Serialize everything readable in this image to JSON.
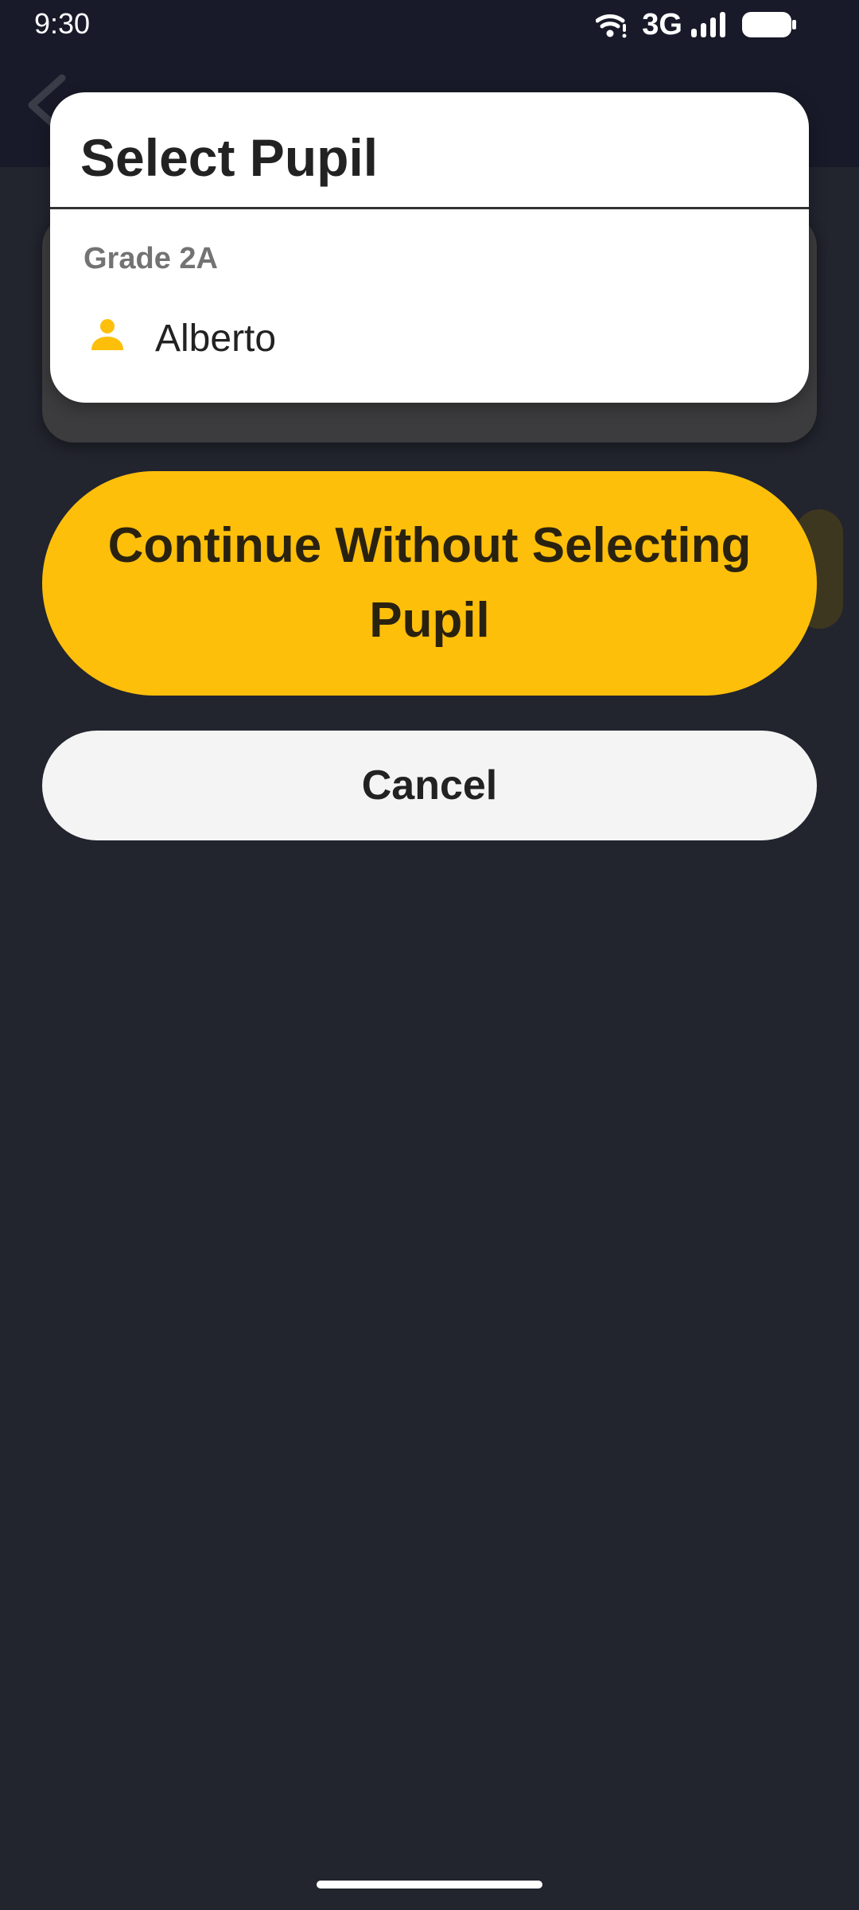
{
  "status_bar": {
    "time": "9:30",
    "network": "3G",
    "icons": [
      "wifi-icon",
      "signal-icon",
      "battery-icon"
    ]
  },
  "dialog": {
    "title": "Select Pupil",
    "groups": [
      {
        "name": "Grade 2A",
        "pupils": [
          {
            "name": "Alberto",
            "icon": "person-icon"
          }
        ]
      }
    ]
  },
  "actions": {
    "continue_label": "Continue Without Selecting Pupil",
    "cancel_label": "Cancel"
  },
  "colors": {
    "accent": "#fdbf0a",
    "background": "#22242e",
    "status_bar": "#181a29",
    "dialog": "#ffffff",
    "cancel_button": "#f4f4f4"
  }
}
